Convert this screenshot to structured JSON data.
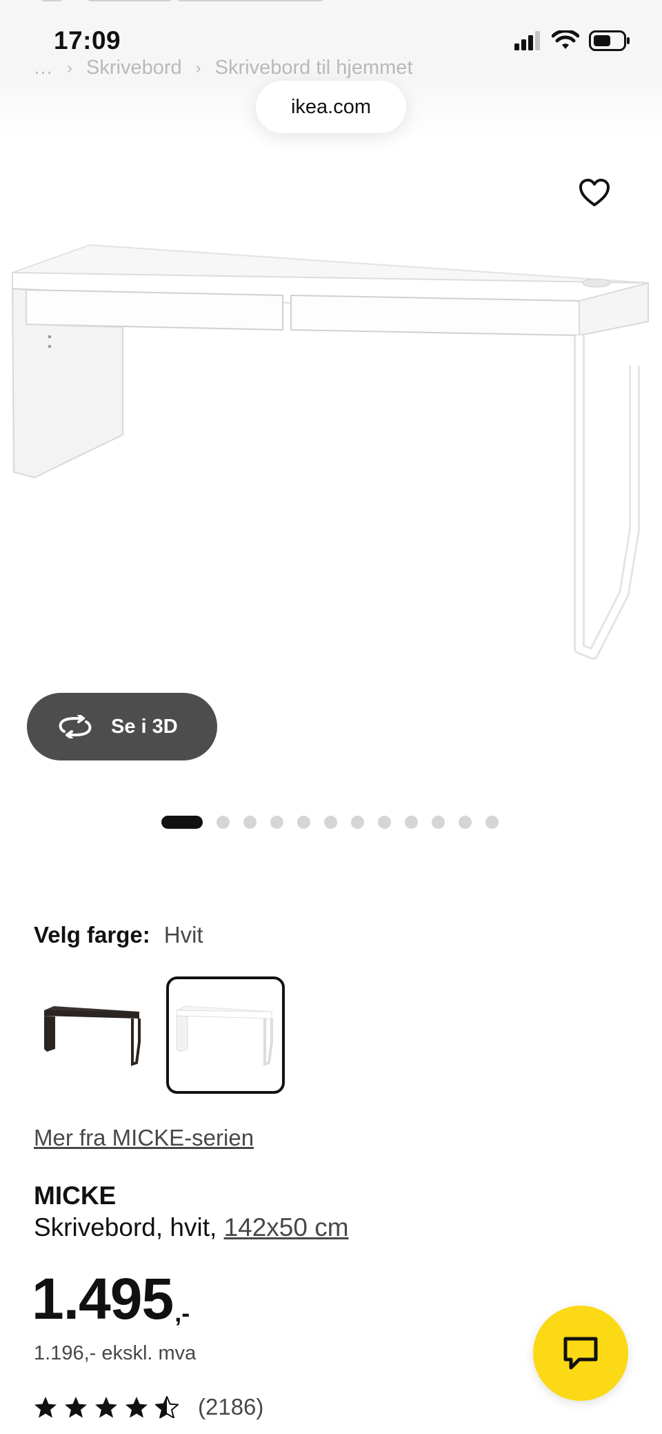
{
  "status_bar": {
    "time": "17:09"
  },
  "breadcrumb": {
    "ellipsis": "…",
    "separator": "›",
    "items": [
      "Skrivebord",
      "Skrivebord til hjemmet"
    ]
  },
  "browser": {
    "url": "ikea.com"
  },
  "gallery": {
    "view_3d_label": "Se i 3D",
    "image_count": 13,
    "active_index": 0
  },
  "color_select": {
    "label": "Velg farge:",
    "value": "Hvit",
    "swatches": [
      {
        "color": "#2b2522",
        "selected": false
      },
      {
        "color": "#ffffff",
        "selected": true
      }
    ]
  },
  "series_link": "Mer fra MICKE-serien",
  "product": {
    "name": "MICKE",
    "description": "Skrivebord, hvit,",
    "size": "142x50 cm",
    "price": "1.495",
    "price_suffix": ",-",
    "price_excl_vat": "1.196,- ekskl. mva",
    "rating": 4.5,
    "review_count": "(2186)"
  },
  "colors": {
    "accent_yellow": "#fbd914",
    "button_dark": "#4d4d4d",
    "text": "#111111",
    "muted": "#484848"
  }
}
